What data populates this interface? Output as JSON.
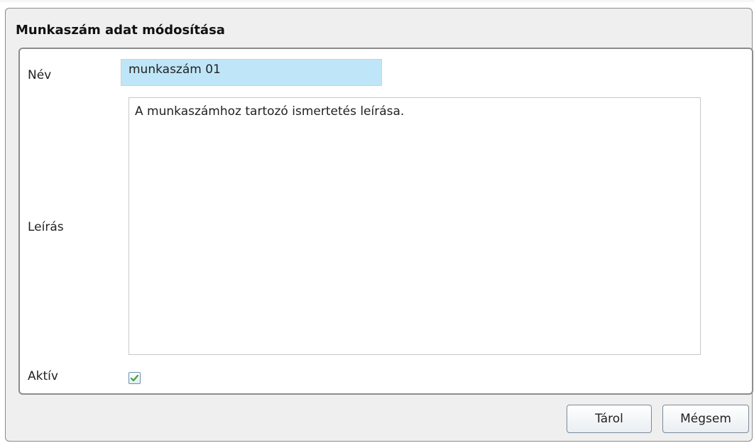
{
  "dialog": {
    "title": "Munkaszám adat módosítása"
  },
  "form": {
    "name_label": "Név",
    "name_value": "munkaszám 01",
    "description_label": "Leírás",
    "description_value": "A munkaszámhoz tartozó ismertetés leírása.",
    "active_label": "Aktív",
    "active_checked": true
  },
  "buttons": {
    "save_label": "Tárol",
    "cancel_label": "Mégsem"
  },
  "colors": {
    "name_field_background": "#bfe6f8",
    "checkmark": "#3aa33a"
  }
}
